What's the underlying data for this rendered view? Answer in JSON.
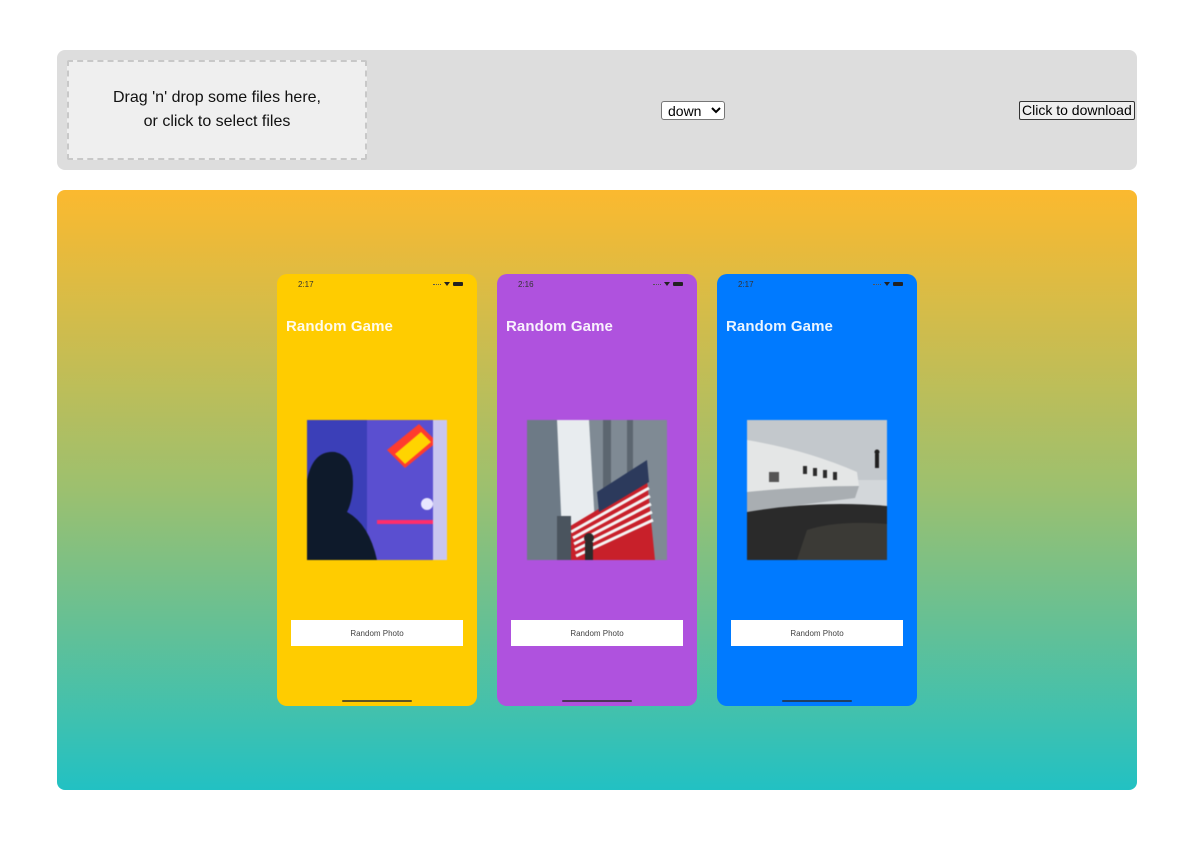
{
  "toolbar": {
    "dropzone_line1": "Drag 'n' drop some files here,",
    "dropzone_line2": "or click to select files",
    "direction_options": [
      "down"
    ],
    "direction_selected": "down",
    "download_label": "Click to download"
  },
  "canvas": {
    "gradient": [
      "#fbb92f",
      "#22c1c3"
    ]
  },
  "phones": [
    {
      "time": "2:17",
      "title": "Random Game",
      "button_label": "Random Photo",
      "background": "#ffcc00",
      "photo": "person-under-neon-light"
    },
    {
      "time": "2:16",
      "title": "Random Game",
      "button_label": "Random Photo",
      "background": "#af52de",
      "photo": "city-skyscrapers-with-flag-billboard"
    },
    {
      "time": "2:17",
      "title": "Random Game",
      "button_label": "Random Photo",
      "background": "#007aff",
      "photo": "plane-wreck-on-black-sand"
    }
  ]
}
